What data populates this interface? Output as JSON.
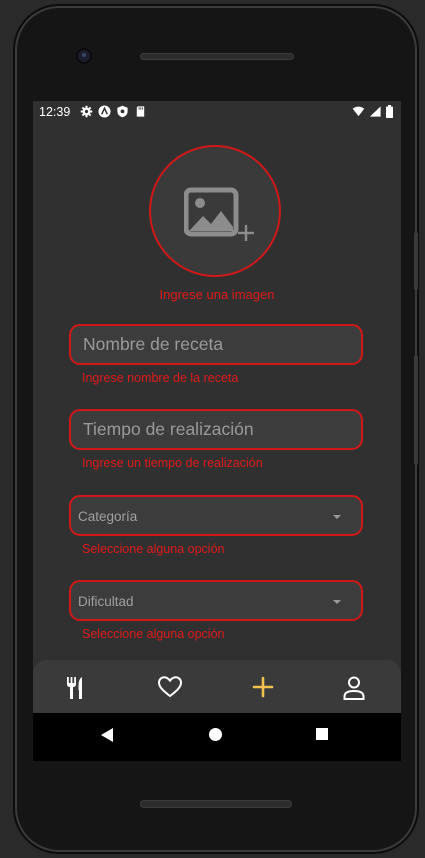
{
  "status_bar": {
    "time": "12:39"
  },
  "image_picker": {
    "error": "Ingrese una imagen"
  },
  "form": {
    "recipe_name": {
      "placeholder": "Nombre de receta",
      "value": "",
      "error": "Ingrese nombre de la receta"
    },
    "prep_time": {
      "placeholder": "Tiempo de realización",
      "value": "",
      "error": "Ingrese un tiempo de realización"
    },
    "category": {
      "selected": "Categoría",
      "error": "Seleccione alguna opción"
    },
    "difficulty": {
      "selected": "Dificultad",
      "error": "Seleccione alguna opción"
    }
  },
  "bottom_nav": {
    "items": [
      {
        "icon": "fork-knife-icon",
        "active": false
      },
      {
        "icon": "heart-icon",
        "active": false
      },
      {
        "icon": "plus-icon",
        "active": true
      },
      {
        "icon": "user-icon",
        "active": false
      }
    ]
  },
  "colors": {
    "error": "#e01b1b",
    "accent": "#f2c14e",
    "background": "#303030"
  }
}
